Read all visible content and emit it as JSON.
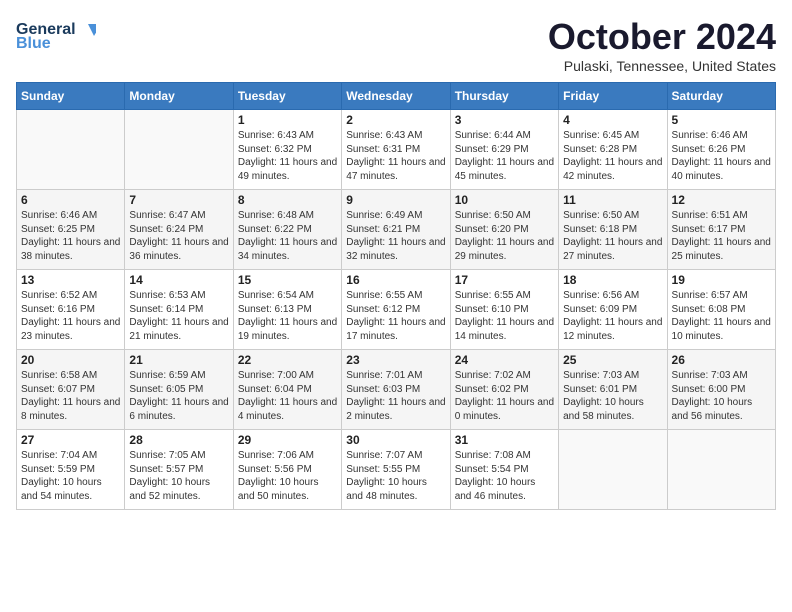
{
  "header": {
    "logo_line1": "General",
    "logo_line2": "Blue",
    "month": "October 2024",
    "location": "Pulaski, Tennessee, United States"
  },
  "days_of_week": [
    "Sunday",
    "Monday",
    "Tuesday",
    "Wednesday",
    "Thursday",
    "Friday",
    "Saturday"
  ],
  "weeks": [
    [
      {
        "day": "",
        "info": ""
      },
      {
        "day": "",
        "info": ""
      },
      {
        "day": "1",
        "info": "Sunrise: 6:43 AM\nSunset: 6:32 PM\nDaylight: 11 hours and 49 minutes."
      },
      {
        "day": "2",
        "info": "Sunrise: 6:43 AM\nSunset: 6:31 PM\nDaylight: 11 hours and 47 minutes."
      },
      {
        "day": "3",
        "info": "Sunrise: 6:44 AM\nSunset: 6:29 PM\nDaylight: 11 hours and 45 minutes."
      },
      {
        "day": "4",
        "info": "Sunrise: 6:45 AM\nSunset: 6:28 PM\nDaylight: 11 hours and 42 minutes."
      },
      {
        "day": "5",
        "info": "Sunrise: 6:46 AM\nSunset: 6:26 PM\nDaylight: 11 hours and 40 minutes."
      }
    ],
    [
      {
        "day": "6",
        "info": "Sunrise: 6:46 AM\nSunset: 6:25 PM\nDaylight: 11 hours and 38 minutes."
      },
      {
        "day": "7",
        "info": "Sunrise: 6:47 AM\nSunset: 6:24 PM\nDaylight: 11 hours and 36 minutes."
      },
      {
        "day": "8",
        "info": "Sunrise: 6:48 AM\nSunset: 6:22 PM\nDaylight: 11 hours and 34 minutes."
      },
      {
        "day": "9",
        "info": "Sunrise: 6:49 AM\nSunset: 6:21 PM\nDaylight: 11 hours and 32 minutes."
      },
      {
        "day": "10",
        "info": "Sunrise: 6:50 AM\nSunset: 6:20 PM\nDaylight: 11 hours and 29 minutes."
      },
      {
        "day": "11",
        "info": "Sunrise: 6:50 AM\nSunset: 6:18 PM\nDaylight: 11 hours and 27 minutes."
      },
      {
        "day": "12",
        "info": "Sunrise: 6:51 AM\nSunset: 6:17 PM\nDaylight: 11 hours and 25 minutes."
      }
    ],
    [
      {
        "day": "13",
        "info": "Sunrise: 6:52 AM\nSunset: 6:16 PM\nDaylight: 11 hours and 23 minutes."
      },
      {
        "day": "14",
        "info": "Sunrise: 6:53 AM\nSunset: 6:14 PM\nDaylight: 11 hours and 21 minutes."
      },
      {
        "day": "15",
        "info": "Sunrise: 6:54 AM\nSunset: 6:13 PM\nDaylight: 11 hours and 19 minutes."
      },
      {
        "day": "16",
        "info": "Sunrise: 6:55 AM\nSunset: 6:12 PM\nDaylight: 11 hours and 17 minutes."
      },
      {
        "day": "17",
        "info": "Sunrise: 6:55 AM\nSunset: 6:10 PM\nDaylight: 11 hours and 14 minutes."
      },
      {
        "day": "18",
        "info": "Sunrise: 6:56 AM\nSunset: 6:09 PM\nDaylight: 11 hours and 12 minutes."
      },
      {
        "day": "19",
        "info": "Sunrise: 6:57 AM\nSunset: 6:08 PM\nDaylight: 11 hours and 10 minutes."
      }
    ],
    [
      {
        "day": "20",
        "info": "Sunrise: 6:58 AM\nSunset: 6:07 PM\nDaylight: 11 hours and 8 minutes."
      },
      {
        "day": "21",
        "info": "Sunrise: 6:59 AM\nSunset: 6:05 PM\nDaylight: 11 hours and 6 minutes."
      },
      {
        "day": "22",
        "info": "Sunrise: 7:00 AM\nSunset: 6:04 PM\nDaylight: 11 hours and 4 minutes."
      },
      {
        "day": "23",
        "info": "Sunrise: 7:01 AM\nSunset: 6:03 PM\nDaylight: 11 hours and 2 minutes."
      },
      {
        "day": "24",
        "info": "Sunrise: 7:02 AM\nSunset: 6:02 PM\nDaylight: 11 hours and 0 minutes."
      },
      {
        "day": "25",
        "info": "Sunrise: 7:03 AM\nSunset: 6:01 PM\nDaylight: 10 hours and 58 minutes."
      },
      {
        "day": "26",
        "info": "Sunrise: 7:03 AM\nSunset: 6:00 PM\nDaylight: 10 hours and 56 minutes."
      }
    ],
    [
      {
        "day": "27",
        "info": "Sunrise: 7:04 AM\nSunset: 5:59 PM\nDaylight: 10 hours and 54 minutes."
      },
      {
        "day": "28",
        "info": "Sunrise: 7:05 AM\nSunset: 5:57 PM\nDaylight: 10 hours and 52 minutes."
      },
      {
        "day": "29",
        "info": "Sunrise: 7:06 AM\nSunset: 5:56 PM\nDaylight: 10 hours and 50 minutes."
      },
      {
        "day": "30",
        "info": "Sunrise: 7:07 AM\nSunset: 5:55 PM\nDaylight: 10 hours and 48 minutes."
      },
      {
        "day": "31",
        "info": "Sunrise: 7:08 AM\nSunset: 5:54 PM\nDaylight: 10 hours and 46 minutes."
      },
      {
        "day": "",
        "info": ""
      },
      {
        "day": "",
        "info": ""
      }
    ]
  ]
}
